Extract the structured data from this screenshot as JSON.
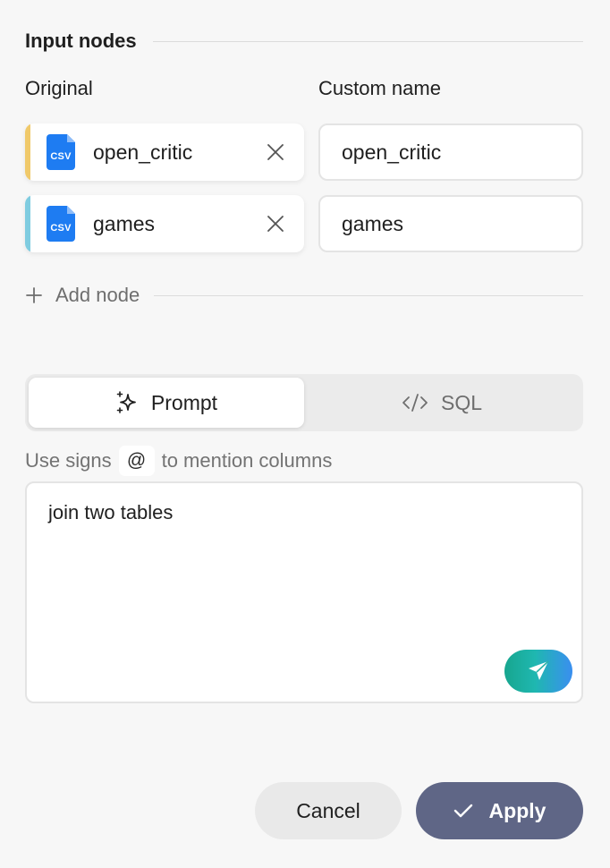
{
  "section": {
    "title": "Input nodes"
  },
  "columns": {
    "original": "Original",
    "custom": "Custom name"
  },
  "nodes": [
    {
      "label": "open_critic",
      "file_type": "CSV",
      "stripe_color": "#f0c96a",
      "custom_name": "open_critic"
    },
    {
      "label": "games",
      "file_type": "CSV",
      "stripe_color": "#7fcce0",
      "custom_name": "games"
    }
  ],
  "add_node": {
    "label": "Add node"
  },
  "mode_toggle": {
    "tabs": [
      {
        "label": "Prompt",
        "icon": "sparkles-icon",
        "active": true
      },
      {
        "label": "SQL",
        "icon": "code-icon",
        "active": false
      }
    ]
  },
  "hint": {
    "prefix": "Use signs",
    "symbol": "@",
    "suffix": "to mention columns"
  },
  "prompt": {
    "text": "join two tables"
  },
  "actions": {
    "cancel": "Cancel",
    "apply": "Apply"
  },
  "colors": {
    "file_icon": "#1e7cf2",
    "apply_button": "#5f6686",
    "send_gradient": [
      "#17a68f",
      "#3a8ff0"
    ]
  }
}
